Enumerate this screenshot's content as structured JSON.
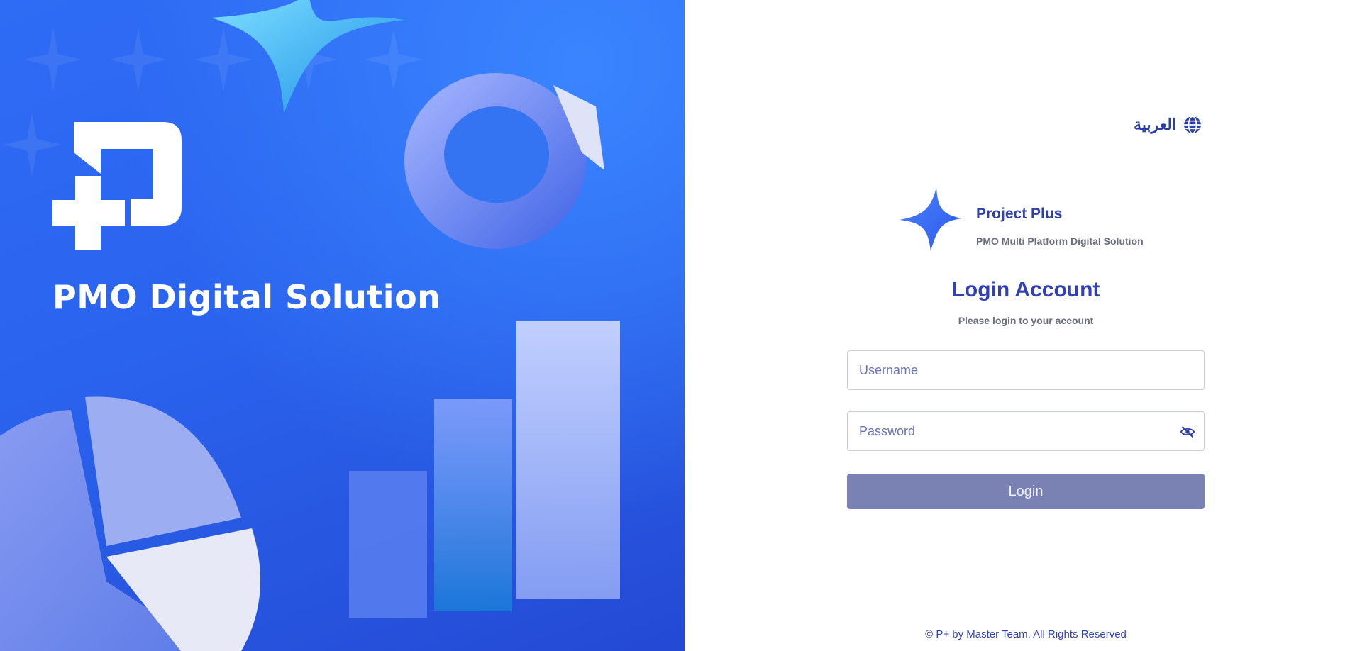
{
  "hero": {
    "title": "PMO Digital Solution",
    "logo_icon": "p-plus-logo-icon"
  },
  "language_switch": {
    "label": "العربية",
    "icon": "globe-icon"
  },
  "brand": {
    "name": "Project Plus",
    "tagline": "PMO Multi Platform Digital Solution",
    "icon": "four-point-star-icon"
  },
  "login": {
    "title": "Login Account",
    "subtitle": "Please login to your account",
    "username_placeholder": "Username",
    "password_placeholder": "Password",
    "password_toggle_icon": "eye-off-icon",
    "submit_label": "Login"
  },
  "footer": {
    "text": "© P+ by Master Team, All Rights Reserved"
  },
  "colors": {
    "hero_background": "#2f6cf5",
    "primary": "#3340b4",
    "button_disabled": "#7a82b4",
    "muted_text": "#6b6f7e"
  }
}
